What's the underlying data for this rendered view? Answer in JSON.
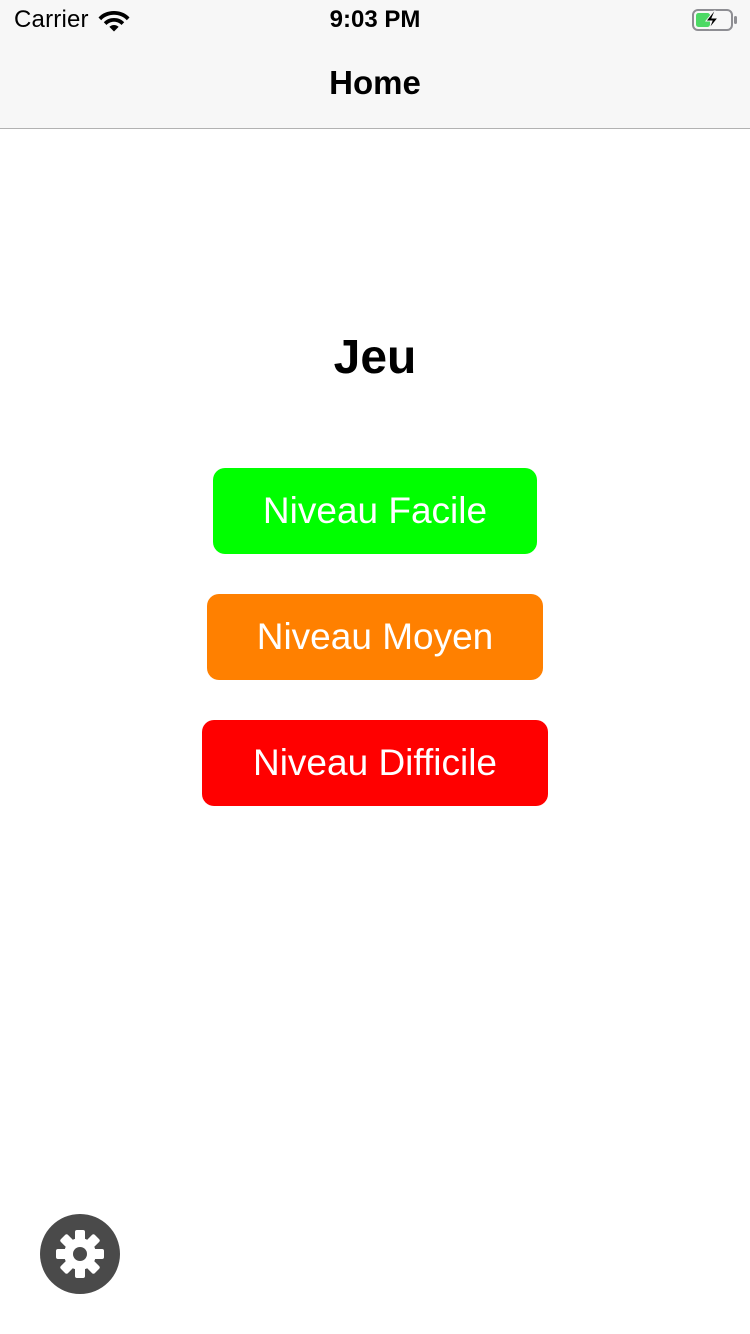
{
  "status_bar": {
    "carrier": "Carrier",
    "time": "9:03 PM",
    "wifi_icon": "wifi-icon",
    "battery_icon": "battery-charging-icon",
    "battery_color": "#4cd964"
  },
  "nav": {
    "title": "Home"
  },
  "main": {
    "title": "Jeu",
    "levels": [
      {
        "label": "Niveau Facile",
        "color": "#00ff00"
      },
      {
        "label": "Niveau Moyen",
        "color": "#ff8000"
      },
      {
        "label": "Niveau Difficile",
        "color": "#ff0000"
      }
    ]
  },
  "settings": {
    "icon": "gear-icon",
    "background": "#4a4a4a"
  }
}
